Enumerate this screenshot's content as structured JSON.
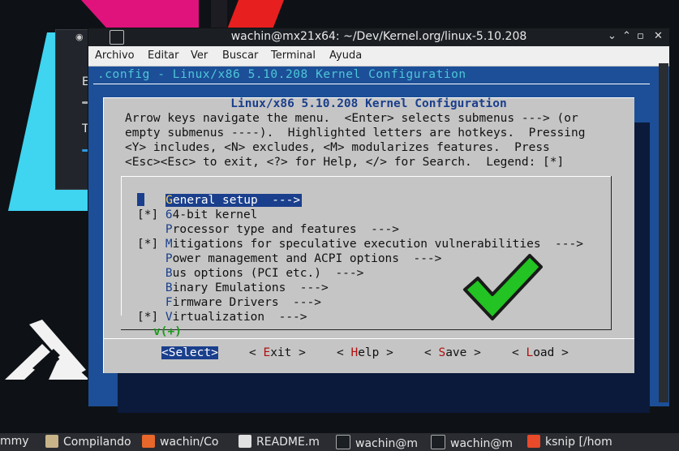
{
  "window": {
    "title": "wachin@mx21x64: ~/Dev/Kernel.org/linux-5.10.208",
    "controls": [
      "⌄",
      "⌃",
      "▫",
      "✕"
    ]
  },
  "menu": [
    "Archivo",
    "Editar",
    "Ver",
    "Buscar",
    "Terminal",
    "Ayuda"
  ],
  "header": ".config - Linux/x86 5.10.208 Kernel Configuration",
  "dialog": {
    "title": " Linux/x86 5.10.208 Kernel Configuration ",
    "help": [
      "Arrow keys navigate the menu.  <Enter> selects submenus ---> (or",
      "empty submenus ----).  Highlighted letters are hotkeys.  Pressing",
      "<Y> includes, <N> excludes, <M> modularizes features.  Press",
      "<Esc><Esc> to exit, <?> for Help, </> for Search.  Legend: [*]"
    ],
    "items": [
      {
        "prefix": "    ",
        "hot": "G",
        "rest": "eneral setup  --->",
        "selected": true
      },
      {
        "prefix": "[*] ",
        "hot": "6",
        "rest": "4-bit kernel",
        "selected": false
      },
      {
        "prefix": "    ",
        "hot": "P",
        "rest": "rocessor type and features  --->",
        "selected": false
      },
      {
        "prefix": "[*] ",
        "hot": "M",
        "rest": "itigations for speculative execution vulnerabilities  --->",
        "selected": false
      },
      {
        "prefix": "    ",
        "hot": "P",
        "rest": "ower management and ACPI options  --->",
        "selected": false
      },
      {
        "prefix": "    ",
        "hot": "B",
        "rest": "us options (PCI etc.)  --->",
        "selected": false
      },
      {
        "prefix": "    ",
        "hot": "B",
        "rest": "inary Emulations  --->",
        "selected": false
      },
      {
        "prefix": "    ",
        "hot": "F",
        "rest": "irmware Drivers  --->",
        "selected": false
      },
      {
        "prefix": "[*] ",
        "hot": "V",
        "rest": "irtualization  --->",
        "selected": false
      }
    ],
    "more": "v(+)",
    "buttons": [
      {
        "pre": "<",
        "hot": "S",
        "rest": "elect>",
        "selected": true
      },
      {
        "pre": "< ",
        "hot": "E",
        "rest": "xit >",
        "selected": false
      },
      {
        "pre": "< ",
        "hot": "H",
        "rest": "elp >",
        "selected": false
      },
      {
        "pre": "< ",
        "hot": "S",
        "rest": "ave >",
        "selected": false
      },
      {
        "pre": "< ",
        "hot": "L",
        "rest": "oad >",
        "selected": false
      }
    ]
  },
  "taskbar": [
    {
      "label": "mmy",
      "icon": "none"
    },
    {
      "label": "Compilando",
      "icon": "folder-icon"
    },
    {
      "label": "wachin/Co",
      "icon": "firefox-icon"
    },
    {
      "label": "README.m",
      "icon": "text-editor-icon"
    },
    {
      "label": "wachin@m",
      "icon": "terminal-icon"
    },
    {
      "label": "wachin@m",
      "icon": "terminal-icon"
    },
    {
      "label": "ksnip [/hom",
      "icon": "ksnip-icon"
    }
  ],
  "colors": {
    "terminal_bg": "#1c4f97",
    "dialog_bg": "#c5c5c5",
    "hotkey": "#1a3f8c",
    "button_hotkey": "#b01010",
    "check": "#22c322"
  }
}
